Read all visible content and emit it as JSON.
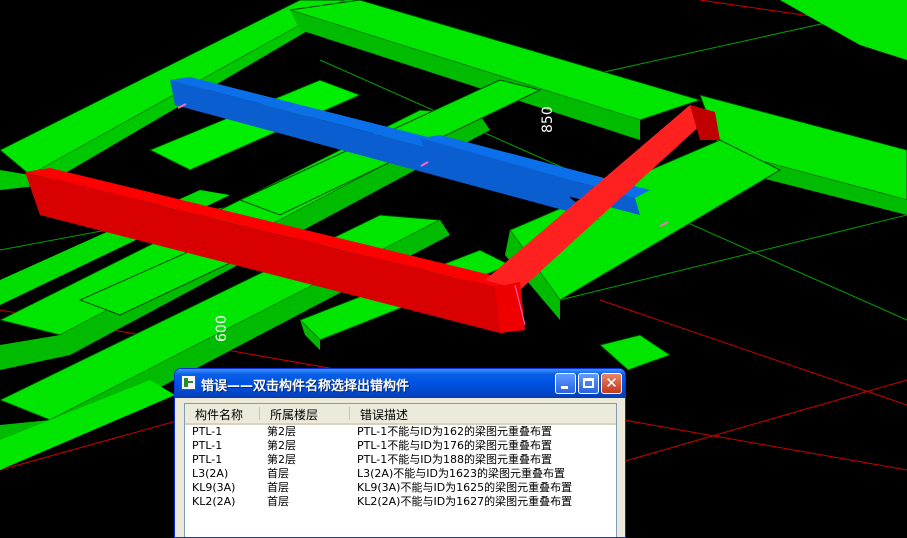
{
  "viewport": {
    "dimension_labels": {
      "vertical_dim_1": "850",
      "vertical_dim_2": "600"
    },
    "colors": {
      "background": "#000000",
      "beam_green": "#00ff00",
      "beam_red": "#ff0000",
      "beam_blue": "#0a6fe8",
      "axis_line_red": "#cc0000",
      "axis_line_green": "#00aa00"
    }
  },
  "dialog": {
    "title": "错误——双击构件名称选择出错构件",
    "app_icon": "app-icon",
    "buttons": {
      "minimize": "minimize-icon",
      "maximize": "maximize-icon",
      "close": "close-icon"
    },
    "close_glyph": "✕",
    "columns": {
      "name": "构件名称",
      "floor": "所属楼层",
      "description": "错误描述"
    },
    "rows": [
      {
        "name": "PTL-1",
        "floor": "第2层",
        "description": "PTL-1不能与ID为162的梁图元重叠布置"
      },
      {
        "name": "PTL-1",
        "floor": "第2层",
        "description": "PTL-1不能与ID为176的梁图元重叠布置"
      },
      {
        "name": "PTL-1",
        "floor": "第2层",
        "description": "PTL-1不能与ID为188的梁图元重叠布置"
      },
      {
        "name": "L3(2A)",
        "floor": "首层",
        "description": "L3(2A)不能与ID为1623的梁图元重叠布置"
      },
      {
        "name": "KL9(3A)",
        "floor": "首层",
        "description": "KL9(3A)不能与ID为1625的梁图元重叠布置"
      },
      {
        "name": "KL2(2A)",
        "floor": "首层",
        "description": "KL2(2A)不能与ID为1627的梁图元重叠布置"
      }
    ]
  }
}
